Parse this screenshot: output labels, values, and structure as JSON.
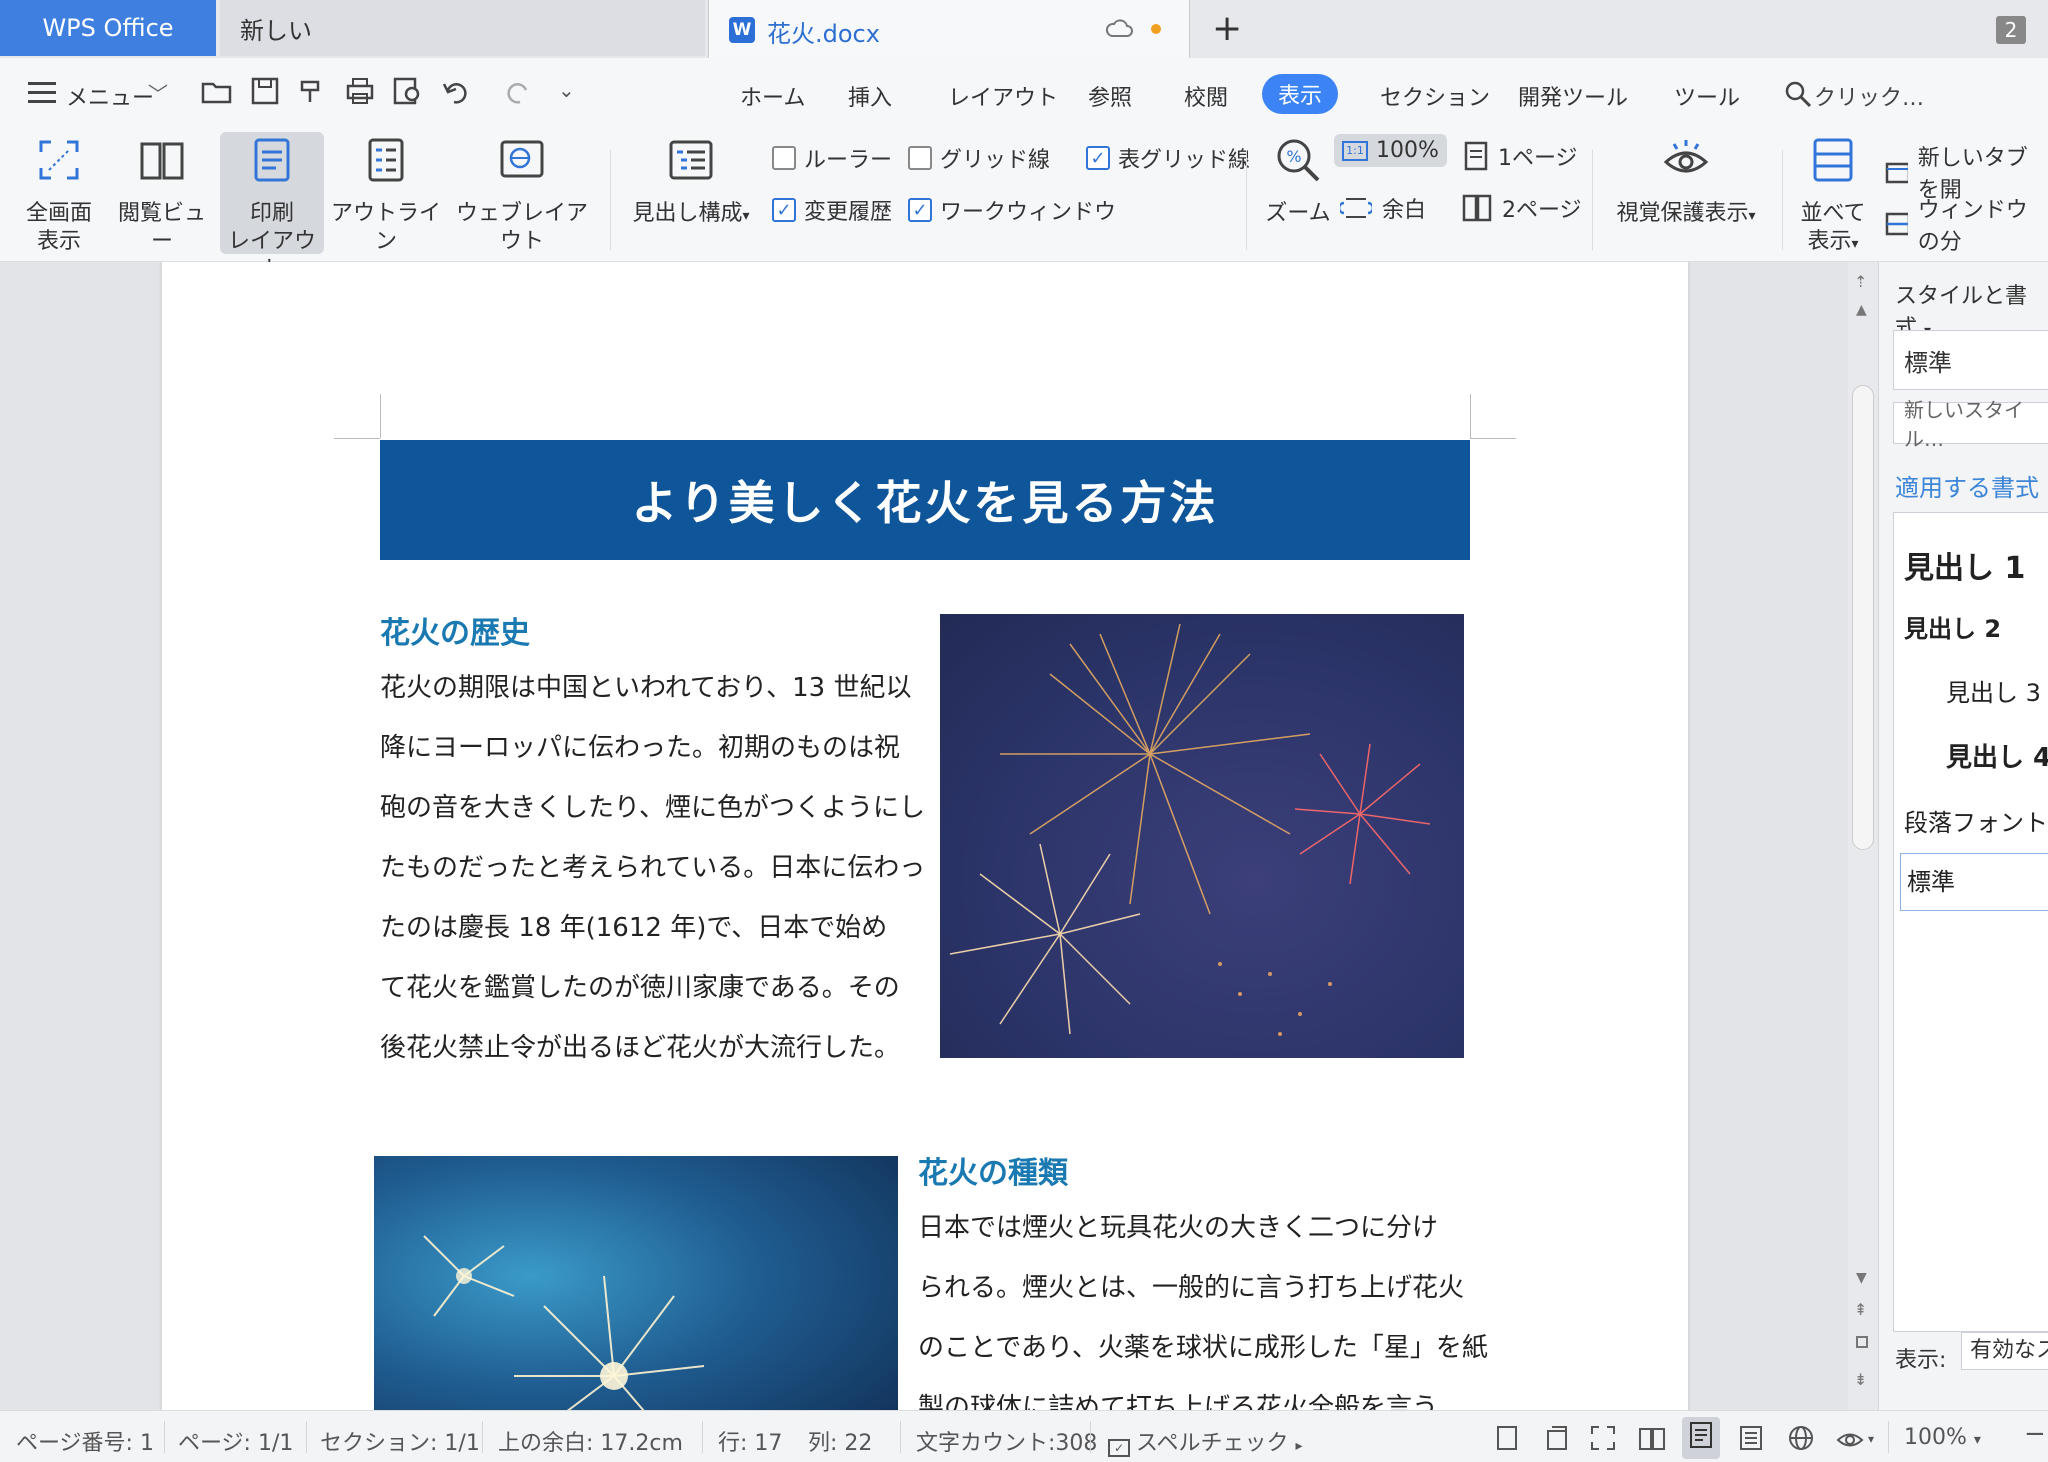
{
  "tabs": {
    "wps": "WPS Office",
    "new": "新しい",
    "doc": "花火.docx",
    "window_count": "2"
  },
  "quick_access": {
    "menu": "メニュー"
  },
  "menu_tabs": [
    "ホーム",
    "挿入",
    "レイアウト",
    "参照",
    "校閲",
    "表示",
    "セクション",
    "開発ツール",
    "ツール"
  ],
  "active_tab": "表示",
  "search_placeholder": "クリック…",
  "ribbon": {
    "fullscreen": [
      "全画面",
      "表示"
    ],
    "reading": "閲覧ビュー",
    "print_layout": [
      "印刷",
      "レイアウト"
    ],
    "outline": "アウトライン",
    "web_layout": "ウェブレイアウト",
    "nav_pane": "見出し構成",
    "ruler": "ルーラー",
    "gridlines": "グリッド線",
    "table_gridlines": "表グリッド線",
    "track_changes": "変更履歴",
    "task_window": "ワークウィンドウ",
    "zoom": "ズーム",
    "zoom_value": "100%",
    "one_page": "1ページ",
    "margins": "余白",
    "two_pages": "2ページ",
    "eye_protect": "視覚保護表示",
    "arrange": [
      "並べて",
      "表示"
    ],
    "new_tab": "新しいタブを開",
    "split_window": "ウィンドウの分"
  },
  "checks": {
    "ruler": false,
    "gridlines": false,
    "table_gridlines": true,
    "track_changes": true,
    "task_window": true
  },
  "document": {
    "title": "より美しく花火を見る方法",
    "section1_heading": "花火の歴史",
    "section1_lines": [
      "花火の期限は中国といわれており、13 世紀以",
      "降にヨーロッパに伝わった。初期のものは祝",
      "砲の音を大きくしたり、煙に色がつくようにし",
      "たものだったと考えられている。日本に伝わっ",
      "たのは慶長 18 年(1612 年)で、日本で始め",
      "て花火を鑑賞したのが徳川家康である。その",
      "後花火禁止令が出るほど花火が大流行した。"
    ],
    "section2_heading": "花火の種類",
    "section2_lines": [
      "日本では煙火と玩具花火の大きく二つに分け",
      "られる。煙火とは、一般的に言う打ち上げ花火",
      "のことであり、火薬を球状に成形した「星」を紙",
      "製の球体に詰めて打ち上げる花火全般を言う"
    ]
  },
  "styles_panel": {
    "title": "スタイルと書式",
    "current": "標準",
    "new_style": "新しいスタイル…",
    "apply_label": "適用する書式",
    "items": [
      "見出し 1",
      "見出し 2",
      "見出し 3",
      "見出し 4",
      "段落フォント",
      "標準"
    ],
    "show_label": "表示:",
    "show_value": "有効なス"
  },
  "statusbar": {
    "page_no": "ページ番号: 1",
    "pages": "ページ: 1/1",
    "section": "セクション: 1/1",
    "top_margin": "上の余白: 17.2cm",
    "row": "行: 17",
    "col": "列: 22",
    "word_count": "文字カウント:308",
    "spellcheck": "スペルチェック",
    "zoom": "100%"
  },
  "colors": {
    "accent": "#3c84f5",
    "banner": "#0f5599",
    "heading": "#1b79b2"
  }
}
